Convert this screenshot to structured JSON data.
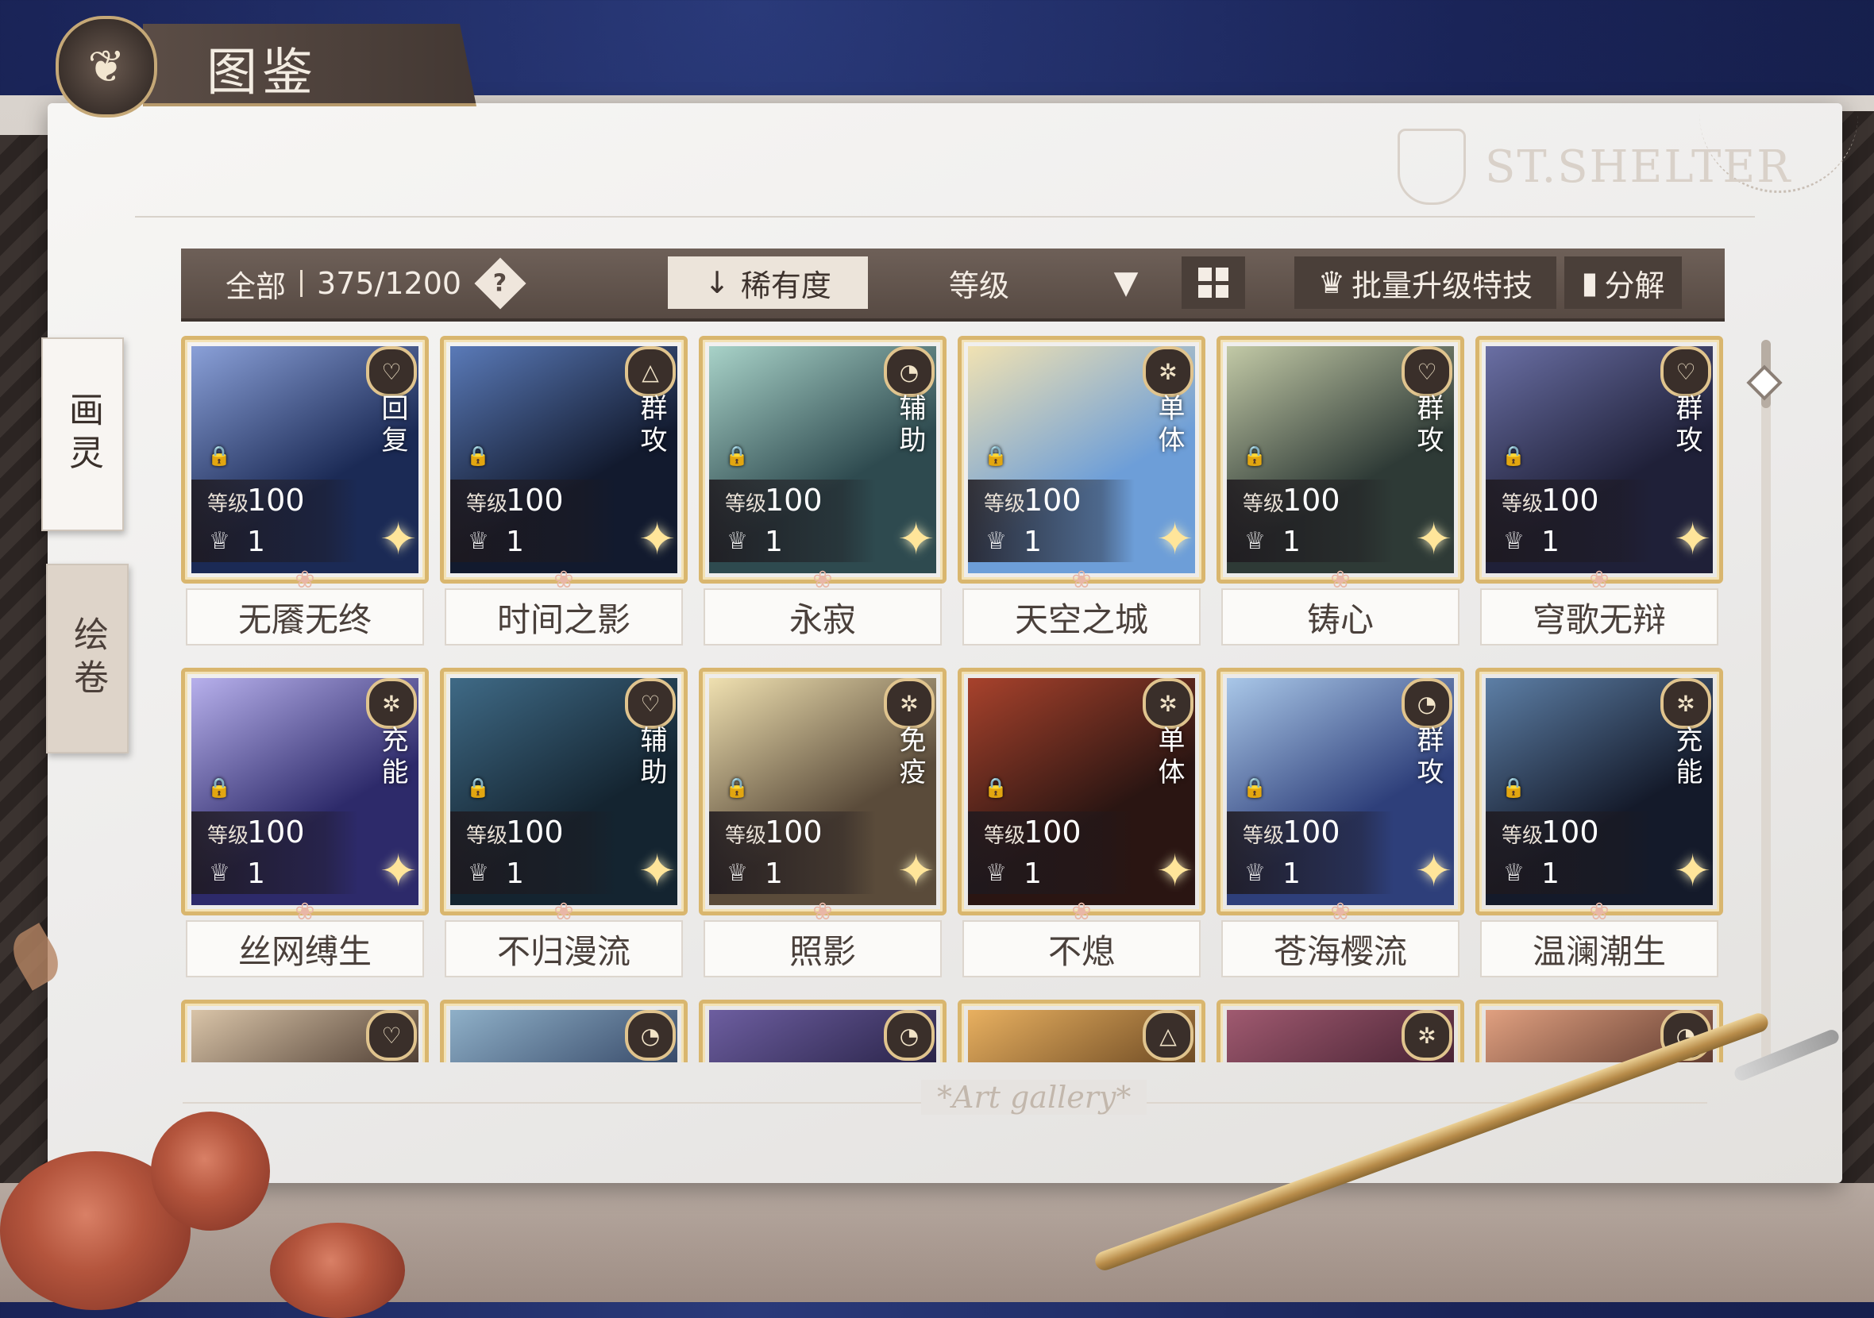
{
  "header": {
    "title": "图鉴",
    "emblem_icon": "butterfly-icon"
  },
  "brand": {
    "text": "ST.SHELTER"
  },
  "side_tabs": [
    {
      "label": "画灵",
      "active": true
    },
    {
      "label": "绘卷",
      "active": false
    }
  ],
  "toolbar": {
    "all_label": "全部",
    "count": "375/1200",
    "help_glyph": "?",
    "rarity_label": "稀有度",
    "level_label": "等级",
    "batch_label": "批量升级特技",
    "dismantle_label": "分解"
  },
  "card_common": {
    "level_prefix": "等级"
  },
  "cards": [
    {
      "name": "无餍无终",
      "role": "回复",
      "role_icon": "heart-pulse-icon",
      "level": "100",
      "rank": "1",
      "color_a": "#1b2a55",
      "color_b": "#8aa0d8"
    },
    {
      "name": "时间之影",
      "role": "群攻",
      "role_icon": "triangle-circle-icon",
      "level": "100",
      "rank": "1",
      "color_a": "#121a2e",
      "color_b": "#5a7ab8"
    },
    {
      "name": "永寂",
      "role": "辅助",
      "role_icon": "segment-circle-icon",
      "level": "100",
      "rank": "1",
      "color_a": "#2e4a4f",
      "color_b": "#a8d2c8"
    },
    {
      "name": "天空之城",
      "role": "单体",
      "role_icon": "cross-diamond-icon",
      "level": "100",
      "rank": "1",
      "color_a": "#6d9ed8",
      "color_b": "#f1e2b2"
    },
    {
      "name": "铸心",
      "role": "群攻",
      "role_icon": "heart-pulse-icon",
      "level": "100",
      "rank": "1",
      "color_a": "#2e3a36",
      "color_b": "#c2c9a6"
    },
    {
      "name": "穹歌无辩",
      "role": "群攻",
      "role_icon": "heart-pulse-icon",
      "level": "100",
      "rank": "1",
      "color_a": "#1f2038",
      "color_b": "#6a6fa4"
    },
    {
      "name": "丝网缚生",
      "role": "充能",
      "role_icon": "cross-diamond-icon",
      "level": "100",
      "rank": "1",
      "color_a": "#2d2a6a",
      "color_b": "#b7b0ec"
    },
    {
      "name": "不归漫流",
      "role": "辅助",
      "role_icon": "heart-pulse-icon",
      "level": "100",
      "rank": "1",
      "color_a": "#142430",
      "color_b": "#3f6a86"
    },
    {
      "name": "照影",
      "role": "免疫",
      "role_icon": "cross-diamond-icon",
      "level": "100",
      "rank": "1",
      "color_a": "#5a4b3a",
      "color_b": "#efe0b0"
    },
    {
      "name": "不熄",
      "role": "单体",
      "role_icon": "cross-diamond-icon",
      "level": "100",
      "rank": "1",
      "color_a": "#2a1512",
      "color_b": "#a8422c"
    },
    {
      "name": "苍海樱流",
      "role": "群攻",
      "role_icon": "segment-circle-icon",
      "level": "100",
      "rank": "1",
      "color_a": "#2e3f7a",
      "color_b": "#a9c7e8"
    },
    {
      "name": "温澜潮生",
      "role": "充能",
      "role_icon": "cross-diamond-icon",
      "level": "100",
      "rank": "1",
      "color_a": "#141a2a",
      "color_b": "#5d7fa6"
    },
    {
      "name": "",
      "role": "",
      "role_icon": "heart-pulse-icon",
      "level": "",
      "rank": "",
      "color_a": "#3a2a22",
      "color_b": "#d9c4a8"
    },
    {
      "name": "",
      "role": "",
      "role_icon": "segment-circle-icon",
      "level": "",
      "rank": "",
      "color_a": "#2a3a5a",
      "color_b": "#8fb0c8"
    },
    {
      "name": "",
      "role": "",
      "role_icon": "segment-circle-icon",
      "level": "",
      "rank": "",
      "color_a": "#1e1a3a",
      "color_b": "#6d5ea0"
    },
    {
      "name": "",
      "role": "",
      "role_icon": "triangle-circle-icon",
      "level": "",
      "rank": "",
      "color_a": "#5a3a1a",
      "color_b": "#e8b060"
    },
    {
      "name": "",
      "role": "",
      "role_icon": "cross-diamond-icon",
      "level": "",
      "rank": "",
      "color_a": "#3a1a2a",
      "color_b": "#a05a70"
    },
    {
      "name": "",
      "role": "",
      "role_icon": "segment-circle-icon",
      "level": "",
      "rank": "",
      "color_a": "#4a2a22",
      "color_b": "#e0a080"
    }
  ],
  "footer": {
    "caption": "*Art gallery*"
  }
}
